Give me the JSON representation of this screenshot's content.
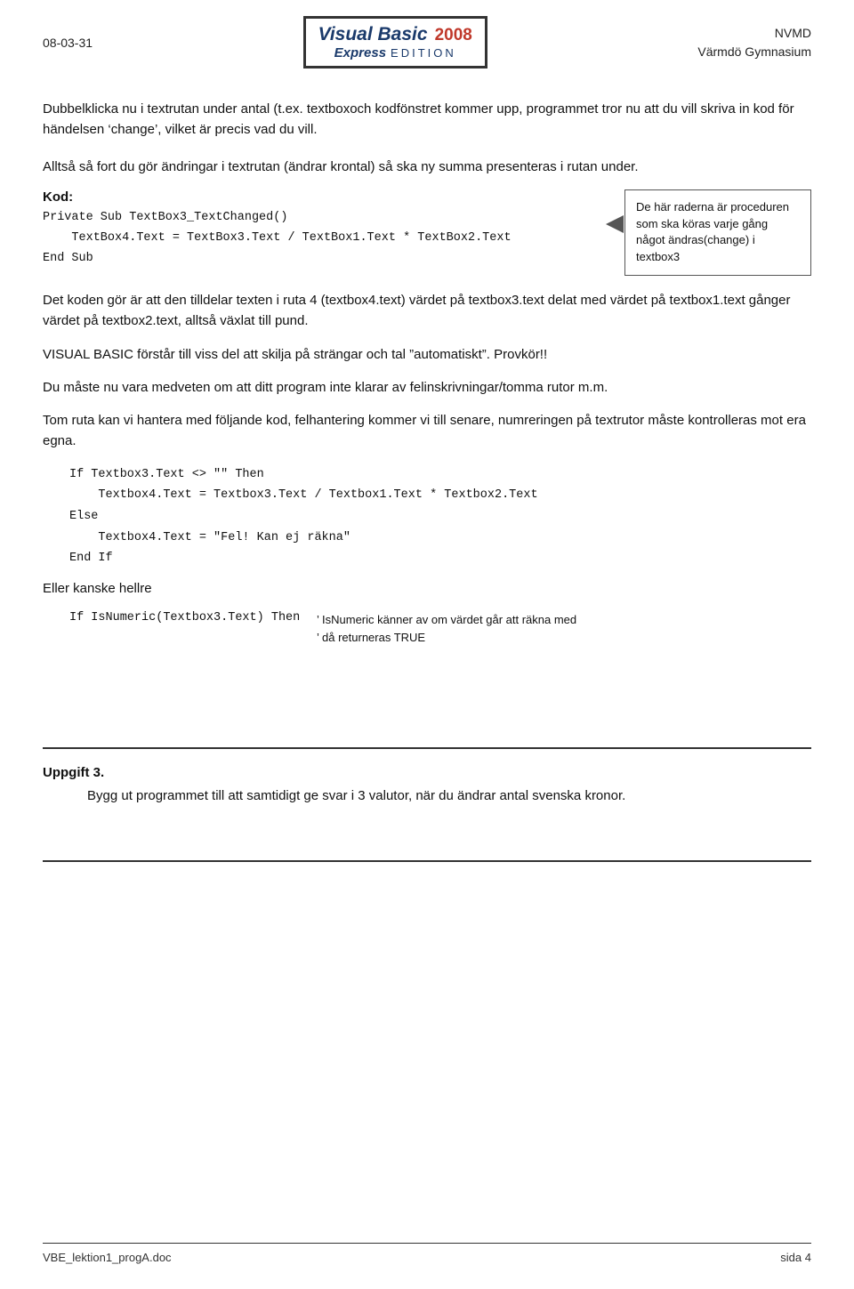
{
  "header": {
    "date": "08-03-31",
    "logo_line1": "Visual Basic",
    "logo_year": "2008",
    "logo_express": "Express",
    "logo_edition": "Edition",
    "school_line1": "NVMD",
    "school_line2": "Värmdö Gymnasium"
  },
  "intro": {
    "para1": "Dubbelklicka nu i textrutan under antal (t.ex. textboxoch kodfönstret kommer upp, programmet tror nu att du vill skriva in kod för händelsen ‘change’, vilket är precis vad du vill.",
    "para2": "Alltså så fort du gör ändringar i textrutan (ändrar krontal) så ska ny summa presenteras i rutan under."
  },
  "kod": {
    "label": "Kod:",
    "code": "Private Sub TextBox3_TextChanged()\n    TextBox4.Text = TextBox3.Text / TextBox1.Text * TextBox2.Text\nEnd Sub",
    "annotation": "De här raderna är proceduren som ska köras varje gång något ändras(change) i textbox3"
  },
  "explanation": {
    "para1": "Det koden gör är att den tilldelar texten i ruta 4 (textbox4.text) värdet på textbox3.text delat med värdet på textbox1.text gånger värdet på textbox2.text, alltså växlat till pund.",
    "para2": "VISUAL BASIC förstår till viss del att skilja på strängar och tal ”automatiskt”. Provkör!!",
    "para3": "Du måste nu vara medveten om att ditt program inte klarar av felinskrivningar/tomma rutor m.m.",
    "para4": "Tom ruta kan vi hantera med följande kod, felhantering kommer vi till senare, numreringen på textrutor måste kontrolleras mot era egna."
  },
  "code_block2": {
    "line1": "If Textbox3.Text <> \"\" Then",
    "line2": "    Textbox4.Text = Textbox3.Text / Textbox1.Text * Textbox2.Text",
    "line3": "Else",
    "line4": "    Textbox4.Text = \"Fel! Kan ej räkna\"",
    "line5": "End If"
  },
  "eller": {
    "text": "Eller kanske hellre"
  },
  "isnumeric": {
    "code": "If IsNumeric(Textbox3.Text) Then",
    "comment_line1": "’ IsNumeric känner av om värdet går att räkna med",
    "comment_line2": "’ då returneras TRUE"
  },
  "uppgift": {
    "label": "Uppgift 3.",
    "text": "Bygg ut programmet till att samtidigt ge svar i 3 valutor, när du ändrar antal svenska kronor."
  },
  "footer": {
    "left": "VBE_lektion1_progA.doc",
    "right": "sida 4"
  }
}
